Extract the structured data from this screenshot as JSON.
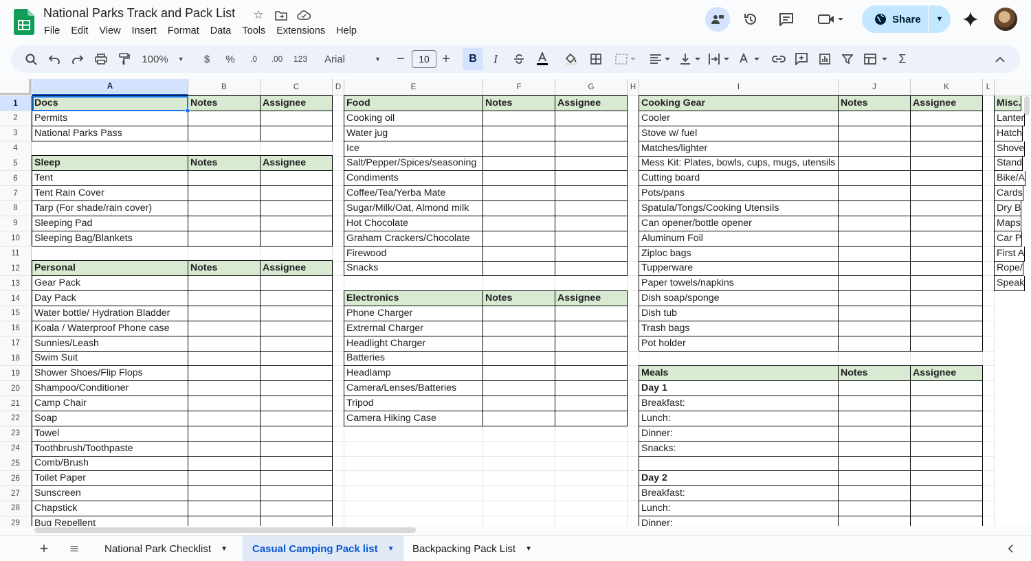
{
  "doc": {
    "title": "National Parks Track and Pack List",
    "menu": [
      "File",
      "Edit",
      "View",
      "Insert",
      "Format",
      "Data",
      "Tools",
      "Extensions",
      "Help"
    ],
    "share_label": "Share"
  },
  "toolbar": {
    "zoom": "100%",
    "currency": "$",
    "percent": "%",
    "dec_decrease": ".0",
    "dec_increase": ".00",
    "number_format": "123",
    "font": "Arial",
    "font_size": "10",
    "bold": "B",
    "italic": "I"
  },
  "grid": {
    "columns": [
      "A",
      "B",
      "C",
      "D",
      "E",
      "F",
      "G",
      "H",
      "I",
      "J",
      "K",
      "L"
    ],
    "rows": [
      "1",
      "2",
      "3",
      "4",
      "5",
      "6",
      "7",
      "8",
      "9",
      "10",
      "11",
      "12",
      "13",
      "14",
      "15",
      "16",
      "17",
      "18",
      "19",
      "20",
      "21",
      "22",
      "23",
      "24",
      "25",
      "26",
      "27",
      "28",
      "29"
    ],
    "sections": {
      "docs": {
        "title": "Docs",
        "notes": "Notes",
        "assignee": "Assignee",
        "items": [
          "Permits",
          "National Parks Pass"
        ]
      },
      "sleep": {
        "title": "Sleep",
        "notes": "Notes",
        "assignee": "Assignee",
        "items": [
          "Tent",
          "Tent Rain Cover",
          "Tarp (For shade/rain cover)",
          "Sleeping Pad",
          "Sleeping Bag/Blankets"
        ]
      },
      "personal": {
        "title": "Personal",
        "notes": "Notes",
        "assignee": "Assignee",
        "items": [
          "Gear Pack",
          "Day Pack",
          "Water bottle/ Hydration Bladder",
          "Koala / Waterproof Phone case",
          "Sunnies/Leash",
          "Swim Suit",
          "Shower Shoes/Flip Flops",
          "Shampoo/Conditioner",
          "Camp Chair",
          "Soap",
          "Towel",
          "Toothbrush/Toothpaste",
          "Comb/Brush",
          "Toilet Paper",
          "Sunscreen",
          "Chapstick",
          "Bug Repellent"
        ]
      },
      "food": {
        "title": "Food",
        "notes": "Notes",
        "assignee": "Assignee",
        "items": [
          "Cooking oil",
          "Water jug",
          "Ice",
          "Salt/Pepper/Spices/seasoning",
          "Condiments",
          "Coffee/Tea/Yerba Mate",
          "Sugar/Milk/Oat, Almond milk",
          "Hot Chocolate",
          "Graham Crackers/Chocolate",
          "Firewood",
          "Snacks"
        ]
      },
      "electronics": {
        "title": "Electronics",
        "notes": "Notes",
        "assignee": "Assignee",
        "items": [
          "Phone Charger",
          "Extrernal Charger",
          "Headlight Charger",
          "Batteries",
          "Headlamp",
          "Camera/Lenses/Batteries",
          "Tripod",
          "Camera Hiking Case"
        ]
      },
      "cooking": {
        "title": "Cooking Gear",
        "notes": "Notes",
        "assignee": "Assignee",
        "items": [
          "Cooler",
          "Stove w/ fuel",
          "Matches/lighter",
          "Mess Kit: Plates, bowls, cups, mugs, utensils",
          "Cutting board",
          "Pots/pans",
          "Spatula/Tongs/Cooking Utensils",
          "Can opener/bottle opener",
          "Aluminum Foil",
          "Ziploc bags",
          "Tupperware",
          "Paper towels/napkins",
          "Dish soap/sponge",
          "Dish tub",
          "Trash bags",
          "Pot holder"
        ]
      },
      "meals": {
        "title": "Meals",
        "notes": "Notes",
        "assignee": "Assignee",
        "items": [
          "Day 1",
          "Breakfast:",
          "Lunch:",
          "Dinner:",
          "Snacks:",
          "",
          "Day 2",
          "Breakfast:",
          "Lunch:",
          "Dinner:"
        ]
      },
      "misc": {
        "title": "Misc.",
        "items": [
          "Lanter",
          "Hatch",
          "Shove",
          "Stand",
          "Bike/A",
          "Cards",
          "Dry B",
          "Maps",
          "Car P",
          "First A",
          "Rope/",
          "Speak"
        ]
      }
    }
  },
  "tabs": [
    {
      "label": "National Park Checklist",
      "active": false
    },
    {
      "label": "Casual Camping Pack list",
      "active": true
    },
    {
      "label": "Backpacking Pack List",
      "active": false
    }
  ]
}
